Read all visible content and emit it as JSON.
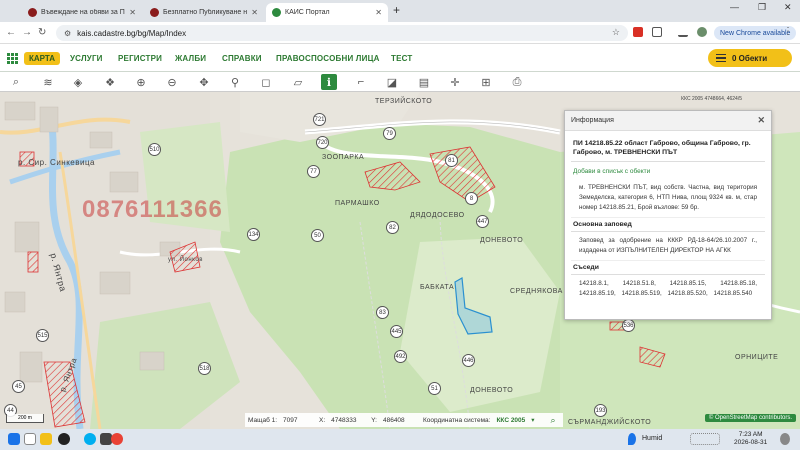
{
  "browser": {
    "tabs": [
      {
        "title": "Въвеждане на обяви за Продажба",
        "favicon_color": "#8a1c1c"
      },
      {
        "title": "Безплатно Публикуване на Обяви",
        "favicon_color": "#8a1c1c"
      },
      {
        "title": "КАИС Портал",
        "favicon_color": "#2d8a3e"
      }
    ],
    "url": "kais.cadastre.bg/bg/Map/Index",
    "new_chrome_label": "New Chrome available",
    "win_minimize": "—",
    "win_restore": "❐",
    "win_close": "✕"
  },
  "app": {
    "karta_label": "КАРТА",
    "menu": [
      "УСЛУГИ",
      "РЕГИСТРИ",
      "ЖАЛБИ",
      "СПРАВКИ",
      "ПРАВОСПОСОБНИ ЛИЦА",
      "ТЕСТ"
    ],
    "objects_label": "0 Обекти",
    "accent": "#2d8a3e",
    "yellow": "#f2c018"
  },
  "toolbar": {
    "tools": [
      "search-icon",
      "layers-icon",
      "layers-stack-icon",
      "zoom-in-icon",
      "zoom-out-icon",
      "pan-icon",
      "location-pin-icon",
      "select-area-icon",
      "select-polygon-icon",
      "info-icon",
      "measure-icon",
      "measure-area-icon",
      "map-book-icon",
      "crosshair-icon",
      "print-icon"
    ]
  },
  "map": {
    "labels": [
      "ТЕРЗИЙСКОТО",
      "ЗООПАРКА",
      "ПАРМАШКО",
      "ДЯДОДОСЕВО",
      "ДОНЕВОТО",
      "БАБКАТА",
      "СРЕДНЯКОВА ЛИВАДА",
      "ДОНЕВОТО",
      "ОРНИЦИТЕ",
      "СЪРМАНДЖИЙСКОТО",
      "р. Сир. Синкевица",
      "р. Янтра",
      "р. Янтра",
      "ул. Йонков"
    ],
    "numbers": [
      "721",
      "720",
      "79",
      "510",
      "77",
      "81",
      "8",
      "447",
      "82",
      "134",
      "50",
      "83",
      "445",
      "492",
      "446",
      "51",
      "193",
      "536",
      "518",
      "515",
      "44",
      "45"
    ],
    "watermark": "0876111366",
    "crs_top": "ККС 2005 4748664, 4624/5",
    "scale_label": "200 m",
    "scale_caption": "Мащаб 1:",
    "scale_value": "7097",
    "x_caption": "X:",
    "x_value": "4748333",
    "y_caption": "Y:",
    "y_value": "486408",
    "crs_caption": "Координатна система:",
    "crs_value": "ККС 2005",
    "osm_credit": "© OpenStreetMap contributors."
  },
  "info": {
    "header": "Информация",
    "title": "ПИ 14218.85.22 област Габрово, община Габрово, гр. Габрово, м. ТРЕВНЕНСКИ ПЪТ",
    "add_link": "Добави в списък с обекти",
    "description": "м. ТРЕВНЕНСКИ ПЪТ, вид собств. Частна, вид територия Земеделска, категория 6, НТП Нива, площ 9324 кв. м, стар номер 14218.85.21, Брой възлове: 59 бр.",
    "order_heading": "Основна заповед",
    "order_text": "Заповед за одобрение на КККР РД-18-64/26.10.2007 г., издадена от ИЗПЪЛНИТЕЛЕН ДИРЕКТОР НА АГКК",
    "neighbours_heading": "Съседи",
    "neighbours": "14218.8.1, 14218.51.8, 14218.85.15, 14218.85.18, 14218.85.19, 14218.85.519, 14218.85.520, 14218.85.540"
  },
  "taskbar": {
    "weather": "Humid",
    "time": "7:23 AM",
    "date": "2026-08-31"
  }
}
